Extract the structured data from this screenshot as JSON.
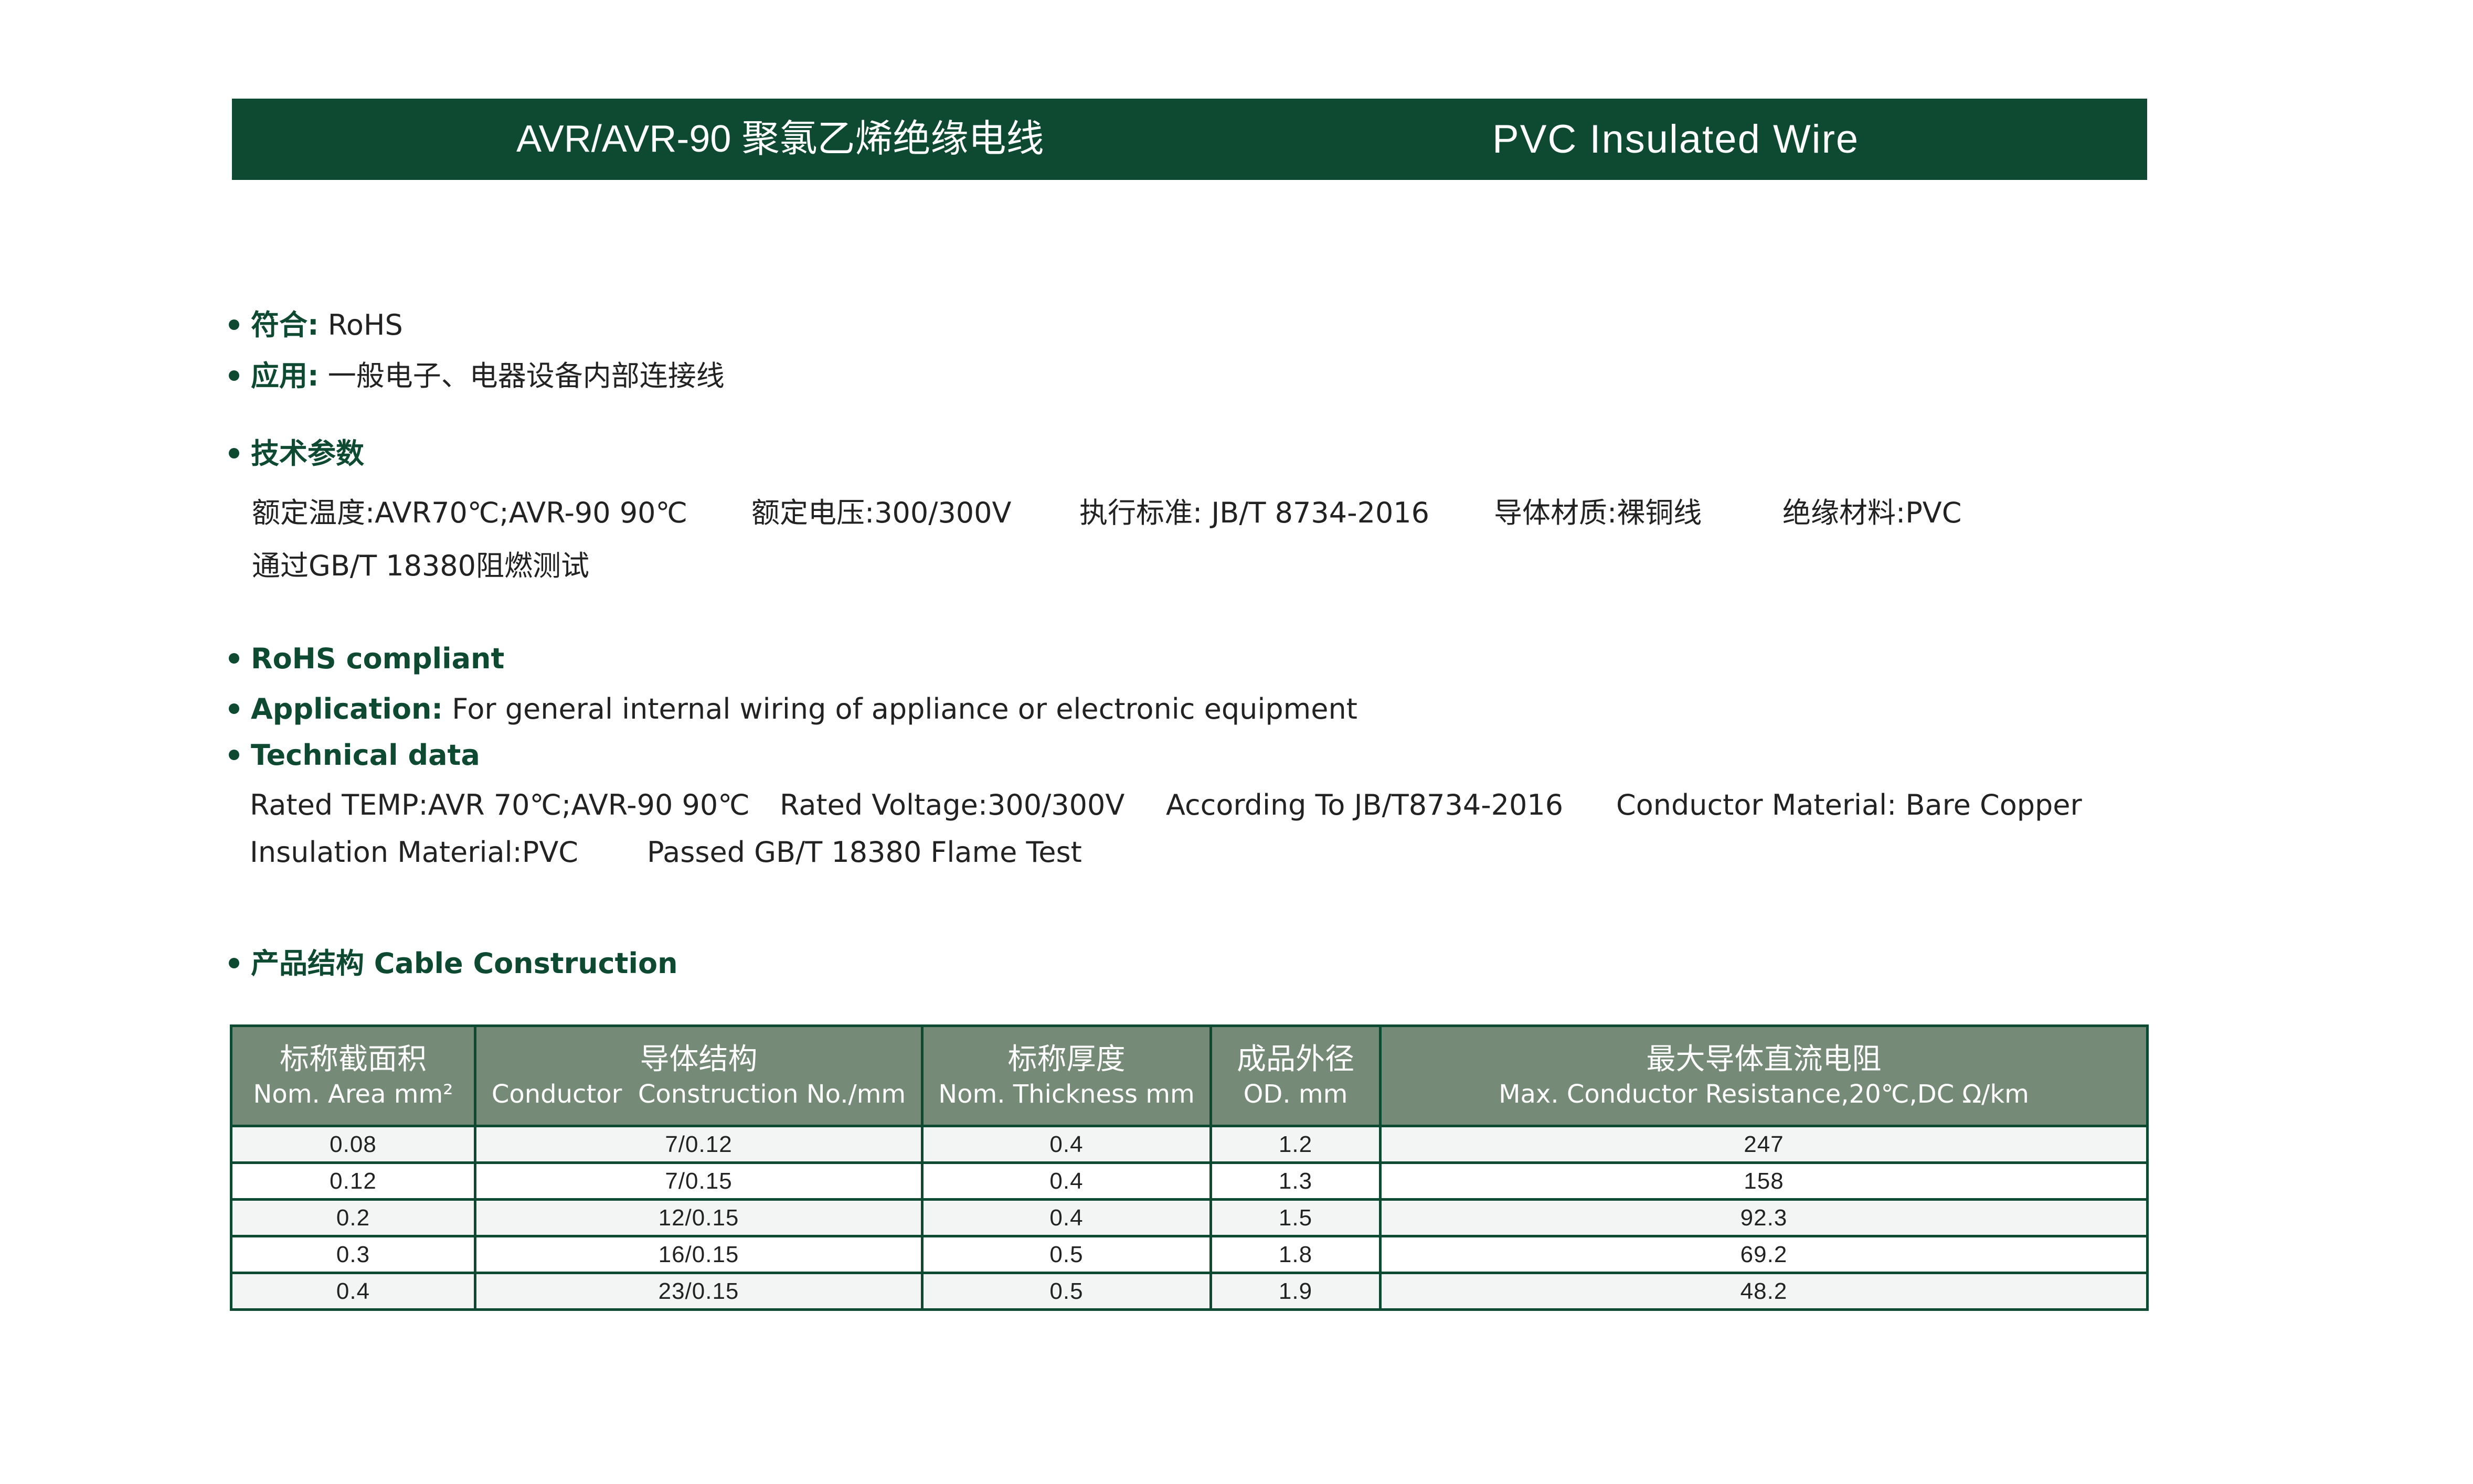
{
  "header": {
    "title_cn": "AVR/AVR-90 聚氯乙烯绝缘电线",
    "title_en": "PVC Insulated Wire"
  },
  "cn_section": {
    "comply_label": "符合:",
    "comply_value": "RoHS",
    "application_label": "应用:",
    "application_value": "一般电子、电器设备内部连接线",
    "tech_label": "技术参数",
    "specs_row1": [
      "额定温度:AVR70℃;AVR-90 90℃",
      "额定电压:300/300V",
      "执行标准: JB/T 8734-2016",
      "导体材质:裸铜线",
      "绝缘材料:PVC"
    ],
    "specs_row2": "通过GB/T 18380阻燃测试"
  },
  "en_section": {
    "rohs_label": "RoHS compliant",
    "application_label": "Application:",
    "application_value": "For general internal wiring of appliance or electronic equipment",
    "tech_label": "Technical data",
    "specs_row1": [
      "Rated TEMP:AVR 70℃;AVR-90 90℃",
      "Rated Voltage:300/300V",
      "According To JB/T8734-2016",
      "Conductor Material: Bare Copper"
    ],
    "specs_row2": [
      "Insulation Material:PVC",
      "Passed GB/T 18380 Flame Test"
    ]
  },
  "construction": {
    "label": "产品结构 Cable Construction"
  },
  "table": {
    "headers": [
      {
        "cn": "标称截面积",
        "en": "Nom. Area mm²"
      },
      {
        "cn": "导体结构",
        "en": "Conductor  Construction No./mm"
      },
      {
        "cn": "标称厚度",
        "en": "Nom. Thickness mm"
      },
      {
        "cn": "成品外径",
        "en": "OD. mm"
      },
      {
        "cn": "最大导体直流电阻",
        "en": "Max. Conductor Resistance,20℃,DC Ω/km"
      }
    ],
    "rows": [
      [
        "0.08",
        "7/0.12",
        "0.4",
        "1.2",
        "247"
      ],
      [
        "0.12",
        "7/0.15",
        "0.4",
        "1.3",
        "158"
      ],
      [
        "0.2",
        "12/0.15",
        "0.4",
        "1.5",
        "92.3"
      ],
      [
        "0.3",
        "16/0.15",
        "0.5",
        "1.8",
        "69.2"
      ],
      [
        "0.4",
        "23/0.15",
        "0.5",
        "1.9",
        "48.2"
      ]
    ]
  },
  "colors": {
    "brand_green": "#0e4a32",
    "table_header_bg": "#768a78",
    "row_alt_bg": "#f3f4f4"
  }
}
